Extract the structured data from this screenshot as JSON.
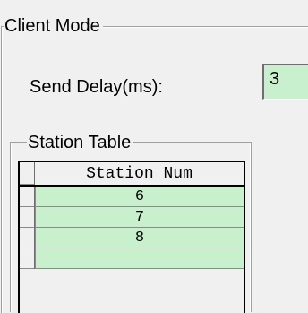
{
  "client_mode": {
    "title": "Client Mode",
    "send_delay_label": "Send Delay(ms):",
    "send_delay_value": "3"
  },
  "station_table": {
    "title": "Station Table",
    "column_header": "Station Num",
    "rows": [
      "6",
      "7",
      "8",
      ""
    ]
  }
}
